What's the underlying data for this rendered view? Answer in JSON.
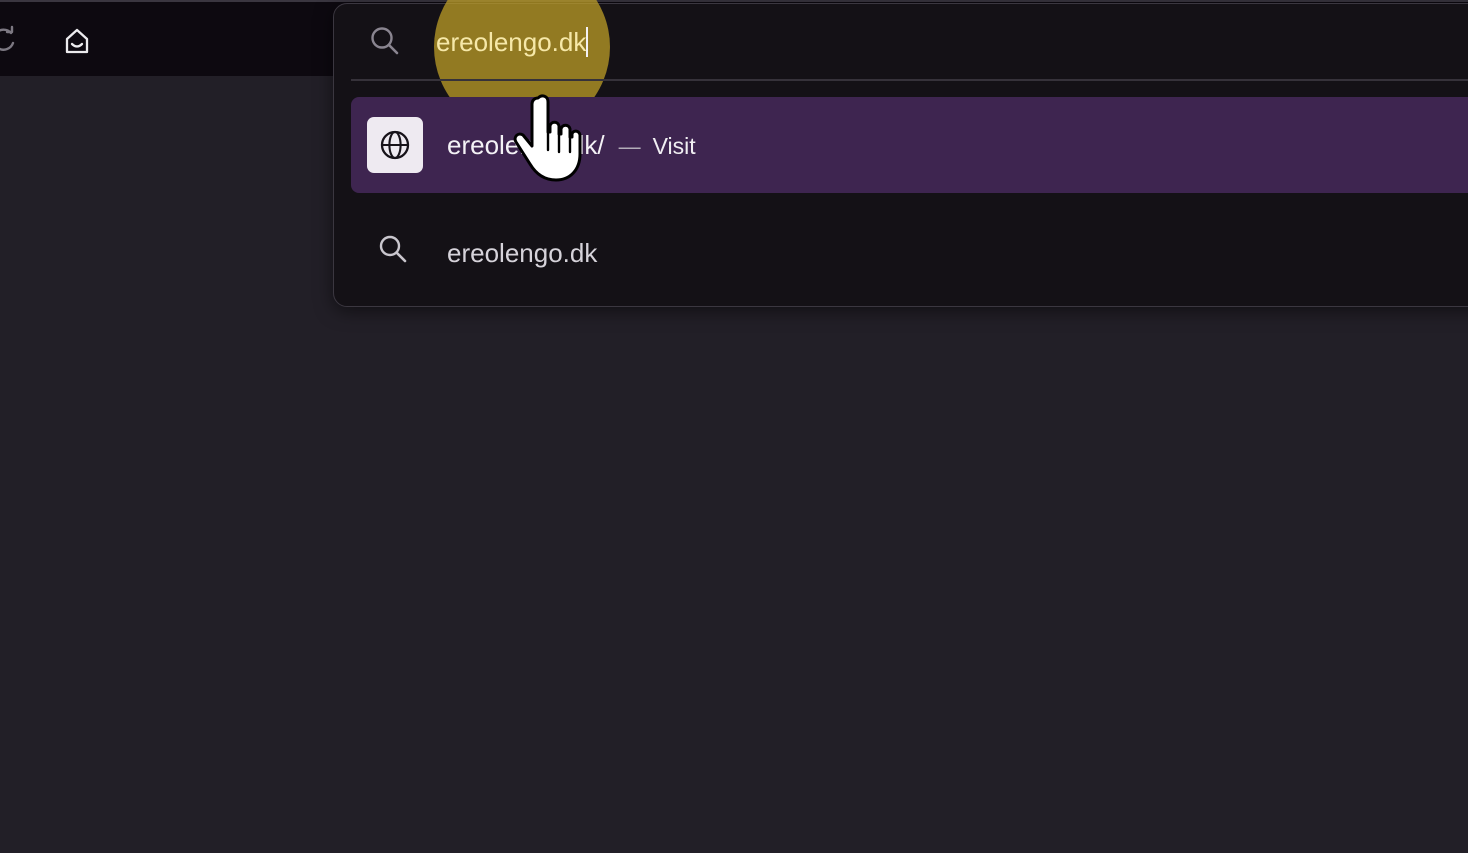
{
  "toolbar": {
    "reload_icon": "reload-icon",
    "home_icon": "home-icon"
  },
  "urlbar": {
    "search_icon": "search-icon",
    "input_value": "ereolengo.dk"
  },
  "results": [
    {
      "type": "visit",
      "icon": "globe-icon",
      "title": "ereolengo.dk/",
      "separator": "—",
      "action": "Visit"
    },
    {
      "type": "search",
      "icon": "search-icon",
      "title": "ereolengo.dk"
    }
  ],
  "colors": {
    "background": "#221f27",
    "toolbar": "#0d0910",
    "popup": "#141116",
    "selected_row": "#3e2550",
    "typed_text": "#f6e8a8",
    "click_highlight": "#c8a628"
  },
  "cursor": "hand-pointer-icon"
}
